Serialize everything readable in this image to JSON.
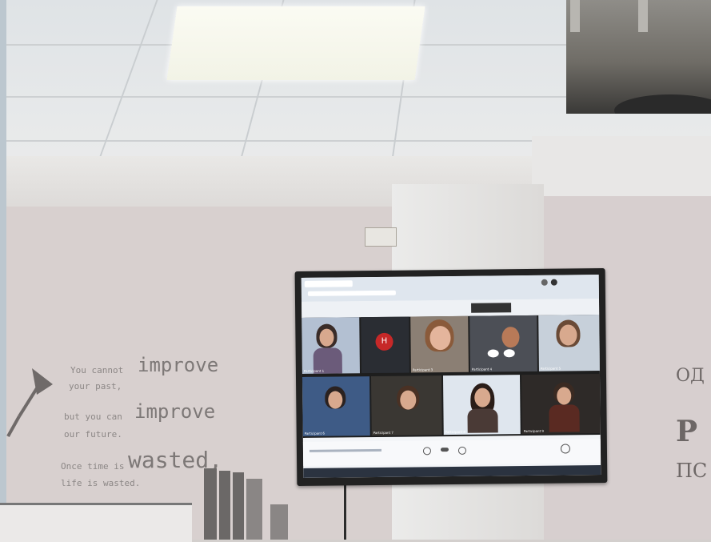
{
  "wall_quote": {
    "line1_a": "You cannot",
    "line1_b": "improve",
    "line2": "your past,",
    "line3_a": "but you can",
    "line3_b": "improve",
    "line4": "our future.",
    "line5_a": "Once time is",
    "line5_b": "wasted,",
    "line6": "life is wasted."
  },
  "wall_right_text": {
    "line1": "ОД",
    "line2": "Р",
    "line3": "ПС"
  },
  "video_call": {
    "participants": [
      {
        "name": "Participant 1"
      },
      {
        "name": "H"
      },
      {
        "name": "Participant 3"
      },
      {
        "name": "Participant 4"
      },
      {
        "name": "Participant 5"
      },
      {
        "name": "Participant 6"
      },
      {
        "name": "Participant 7"
      },
      {
        "name": "Participant 8"
      },
      {
        "name": "Participant 9"
      }
    ]
  },
  "colors": {
    "wall": "#d8d0cf",
    "ceiling": "#e4e7e9",
    "tv_bezel": "#222222"
  }
}
